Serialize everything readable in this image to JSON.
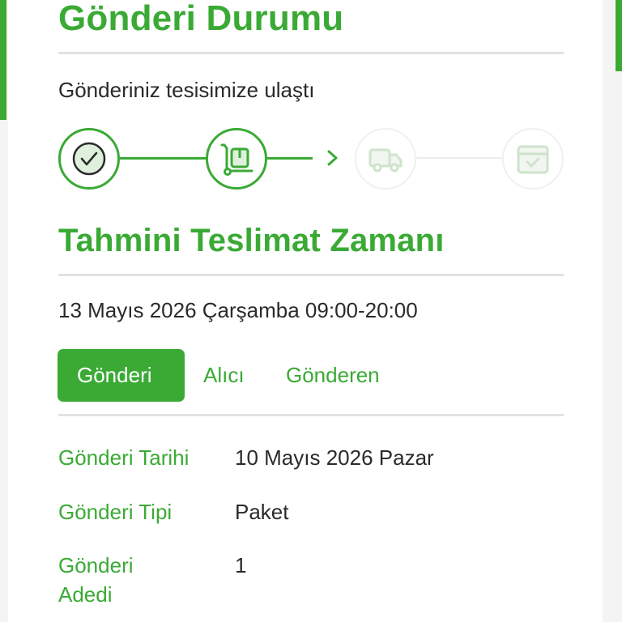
{
  "colors": {
    "accent": "#3aaa35",
    "text": "#2a2a2a",
    "pending": "#e4ece4",
    "divider": "#e2e2e2"
  },
  "header": {
    "title": "Gönderi Durumu"
  },
  "status": {
    "text": "Gönderiniz tesisimize ulaştı"
  },
  "stepper": {
    "steps": [
      {
        "icon": "check-circle-icon",
        "state": "done"
      },
      {
        "icon": "hand-truck-package-icon",
        "state": "done"
      },
      {
        "icon": "delivery-truck-icon",
        "state": "pending"
      },
      {
        "icon": "delivered-box-icon",
        "state": "pending"
      }
    ]
  },
  "estimate": {
    "title": "Tahmini Teslimat Zamanı",
    "value": "13 Mayıs 2026 Çarşamba 09:00-20:00"
  },
  "tabs": [
    {
      "label": "Gönderi",
      "active": true
    },
    {
      "label": "Alıcı",
      "active": false
    },
    {
      "label": "Gönderen",
      "active": false
    }
  ],
  "details": [
    {
      "label": "Gönderi Tarihi",
      "value": "10 Mayıs 2026 Pazar"
    },
    {
      "label": "Gönderi Tipi",
      "value": "Paket"
    },
    {
      "label_line1": "Gönderi",
      "label_line2": "Adedi",
      "value": "1"
    }
  ]
}
